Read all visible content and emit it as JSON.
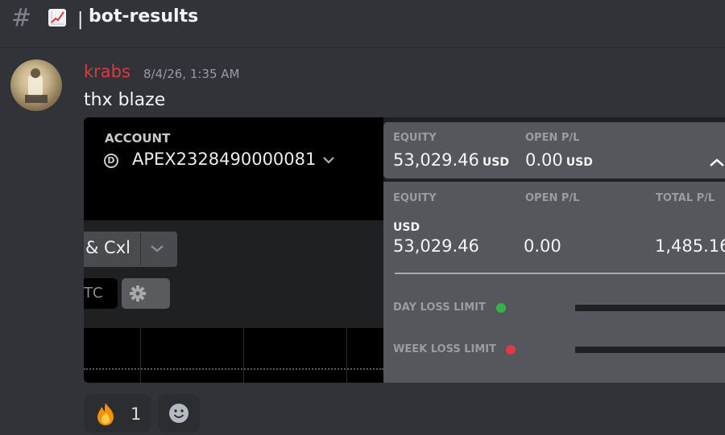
{
  "channel": {
    "hash": "#",
    "separator": "|",
    "name": "bot-results"
  },
  "message": {
    "username": "krabs",
    "timestamp": "8/4/26, 1:35 AM",
    "text": "thx blaze"
  },
  "screenshot": {
    "account_label": "ACCOUNT",
    "account_badge": "D",
    "account_id": "APEX2328490000081",
    "order_button_label": "& Cxl",
    "small_box_label": "TC",
    "summary": {
      "equity_label": "EQUITY",
      "equity_value": "53,029.46",
      "equity_unit": "USD",
      "open_pl_label": "OPEN P/L",
      "open_pl_value": "0.00",
      "open_pl_unit": "USD"
    },
    "details": {
      "equity_label": "EQUITY",
      "open_pl_label": "OPEN P/L",
      "total_pl_label": "TOTAL P/L",
      "currency": "USD",
      "equity_value": "53,029.46",
      "open_pl_value": "0.00",
      "total_pl_value": "1,485.16",
      "day_loss_limit_label": "DAY LOSS LIMIT",
      "week_loss_limit_label": "WEEK LOSS LIMIT"
    },
    "colors": {
      "day_limit_status": "#35b34a",
      "week_limit_status": "#e2384a"
    }
  },
  "reactions": [
    {
      "emoji": "fire-icon",
      "count": "1"
    }
  ],
  "icons": {
    "header_emoji": "chart-increasing-icon",
    "add_reaction": "smiley-icon",
    "settings": "gear-icon"
  },
  "colors": {
    "username": "#d83c3e",
    "background": "#313338"
  }
}
